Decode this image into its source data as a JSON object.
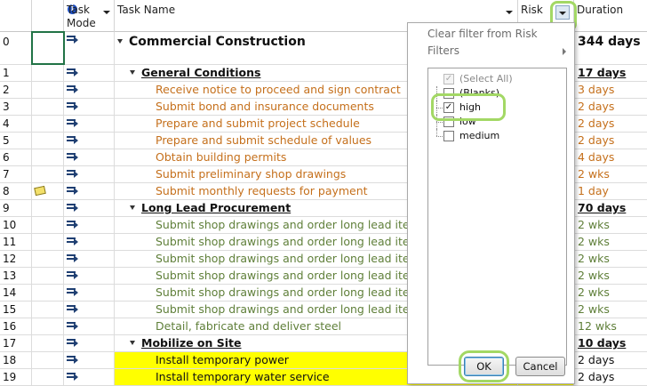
{
  "header": {
    "info_icon": "i",
    "task_mode": "Task Mode",
    "task_name": "Task Name",
    "risk": "Risk",
    "duration": "Duration"
  },
  "rows": [
    {
      "id": "0",
      "name": "Commercial Construction",
      "duration": "344 days"
    },
    {
      "id": "1",
      "name": "General Conditions",
      "duration": "17 days"
    },
    {
      "id": "2",
      "name": "Receive notice to proceed and sign contract",
      "duration": "3 days"
    },
    {
      "id": "3",
      "name": "Submit bond and insurance documents",
      "duration": "2 days"
    },
    {
      "id": "4",
      "name": "Prepare and submit project schedule",
      "duration": "2 days"
    },
    {
      "id": "5",
      "name": "Prepare and submit schedule of values",
      "duration": "2 days"
    },
    {
      "id": "6",
      "name": "Obtain building permits",
      "duration": "4 days"
    },
    {
      "id": "7",
      "name": "Submit preliminary shop drawings",
      "duration": "2 wks"
    },
    {
      "id": "8",
      "name": "Submit monthly requests for payment",
      "duration": "1 day"
    },
    {
      "id": "9",
      "name": "Long Lead Procurement",
      "duration": "70 days"
    },
    {
      "id": "10",
      "name": "Submit shop drawings and order long lead items - steel",
      "duration": "2 wks"
    },
    {
      "id": "11",
      "name": "Submit shop drawings and order long lead items - roofing",
      "duration": "2 wks"
    },
    {
      "id": "12",
      "name": "Submit shop drawings and order long lead items - elevator",
      "duration": "2 wks"
    },
    {
      "id": "13",
      "name": "Submit shop drawings and order long lead items - plumbing",
      "duration": "2 wks"
    },
    {
      "id": "14",
      "name": "Submit shop drawings and order long lead items - electric",
      "duration": "2 wks"
    },
    {
      "id": "15",
      "name": "Submit shop drawings and order long lead items - HVAC",
      "duration": "2 wks"
    },
    {
      "id": "16",
      "name": "Detail, fabricate and deliver steel",
      "duration": "12 wks"
    },
    {
      "id": "17",
      "name": "Mobilize on Site",
      "duration": "10 days"
    },
    {
      "id": "18",
      "name": "Install temporary power",
      "duration": "2 days"
    },
    {
      "id": "19",
      "name": "Install temporary water service",
      "duration": "2 days"
    }
  ],
  "filter_panel": {
    "clear_filter": "Clear filter from Risk",
    "filters": "Filters",
    "items": [
      {
        "label": "(Select All)",
        "check": "✓"
      },
      {
        "label": "(Blanks)",
        "check": ""
      },
      {
        "label": "high",
        "check": "✓"
      },
      {
        "label": "low",
        "check": ""
      },
      {
        "label": "medium",
        "check": ""
      }
    ],
    "ok": "OK",
    "cancel": "Cancel"
  },
  "colors": {
    "summary_text": "#111111",
    "task_orange": "#c5701c",
    "task_green": "#5f7f39",
    "highlight_yellow": "#ffff00",
    "callout_green": "#a3d865"
  }
}
